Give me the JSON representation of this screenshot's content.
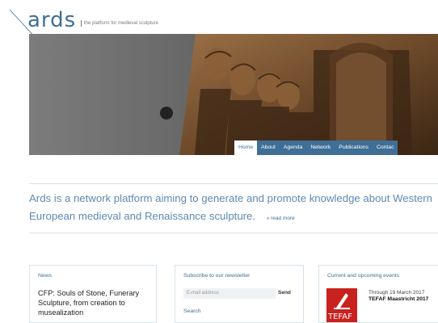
{
  "brand": {
    "logo": "ards",
    "tagline": "the platform for medieval sculpture",
    "accent": "#3f6e97"
  },
  "nav": [
    {
      "label": "Home",
      "active": true
    },
    {
      "label": "About"
    },
    {
      "label": "Agenda"
    },
    {
      "label": "Network"
    },
    {
      "label": "Publications"
    },
    {
      "label": "Contac"
    }
  ],
  "intro": {
    "text": "Ards is a network platform aiming to generate and promote knowledge about Western European medieval and Renaissance sculpture.",
    "read_more": "» read more"
  },
  "news": {
    "title": "News",
    "item": "CFP: Souls of Stone, Funerary Sculpture, from creation to musealization"
  },
  "subscribe": {
    "title": "Subscribe to our newsletter",
    "email_placeholder": "E-mail address",
    "send": "Send",
    "search": "Search"
  },
  "events": {
    "title": "Current and upcoming events",
    "logo_text": "TEFAF",
    "date": "Through 19 March 2017",
    "event_title": "TEFAF Maastricht 2017"
  }
}
